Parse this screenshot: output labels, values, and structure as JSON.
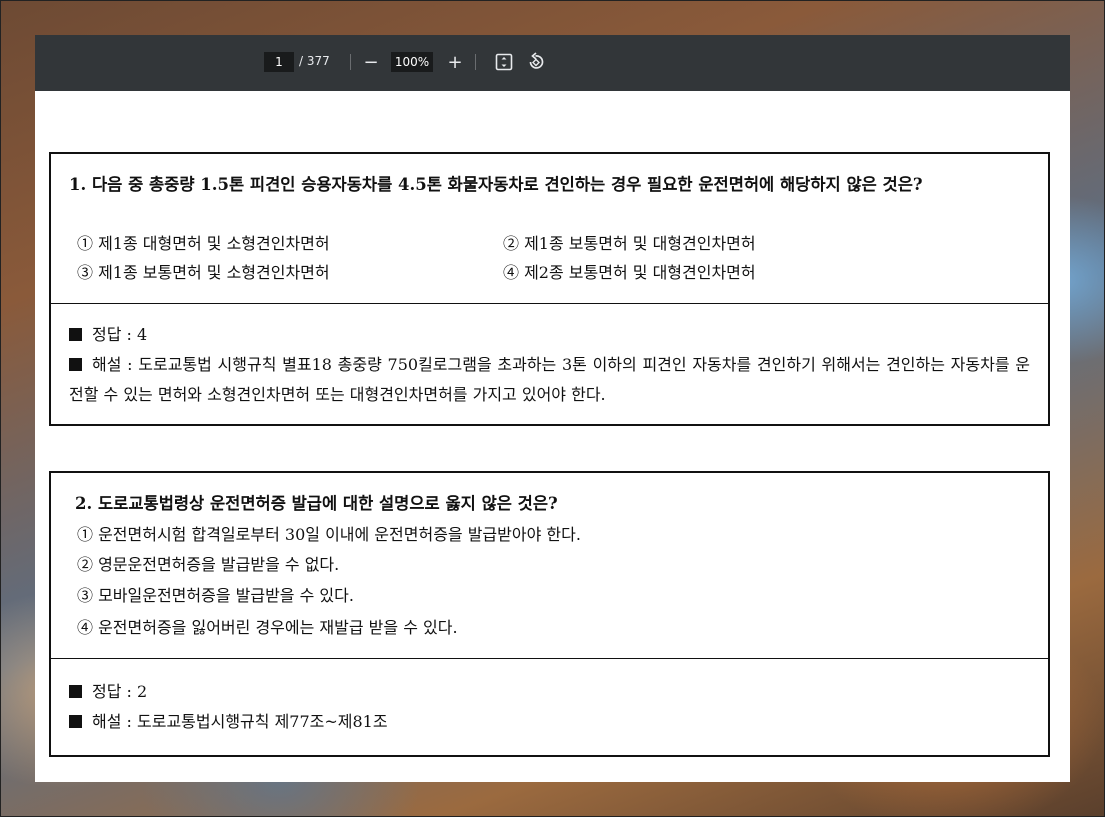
{
  "toolbar": {
    "page_current": "1",
    "page_total": "/ 377",
    "zoom": "100%",
    "minus": "−",
    "plus": "+"
  },
  "questions": [
    {
      "title": "1. 다음 중 총중량 1.5톤 피견인 승용자동차를 4.5톤 화물자동차로 견인하는 경우 필요한 운전면허에 해당하지 않은 것은?",
      "options": [
        "① 제1종 대형면허 및 소형견인차면허",
        "② 제1종 보통면허 및 대형견인차면허",
        "③ 제1종 보통면허 및 소형견인차면허",
        "④ 제2종 보통면허 및 대형견인차면허"
      ],
      "answer": "정답 : 4",
      "explanation": "해설 : 도로교통법 시행규칙 별표18 총중량 750킬로그램을 초과하는 3톤 이하의 피견인 자동차를 견인하기 위해서는 견인하는 자동차를 운전할 수 있는 면허와 소형견인차면허 또는 대형견인차면허를 가지고 있어야 한다."
    },
    {
      "title": "2. 도로교통법령상 운전면허증 발급에 대한 설명으로 옳지 않은 것은?",
      "options": [
        "① 운전면허시험 합격일로부터 30일 이내에 운전면허증을 발급받아야 한다.",
        "② 영문운전면허증을 발급받을 수 없다.",
        "③ 모바일운전면허증을 발급받을 수 있다.",
        "④ 운전면허증을 잃어버린 경우에는 재발급 받을 수 있다."
      ],
      "answer": "정답 : 2",
      "explanation": "해설 : 도로교통법시행규칙 제77조~제81조"
    }
  ]
}
